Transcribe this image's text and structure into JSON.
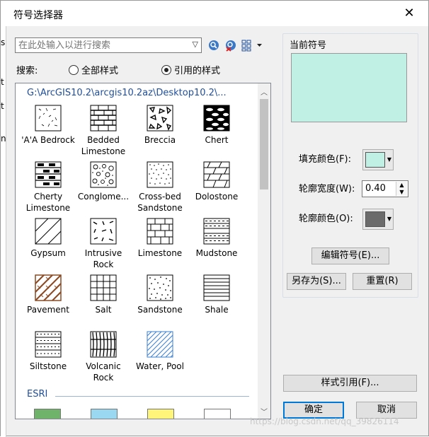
{
  "window": {
    "title": "符号选择器",
    "close_glyph": "✕"
  },
  "left_strip": {
    "fragments": [
      "s",
      "t",
      "t",
      "n"
    ]
  },
  "search": {
    "placeholder": "在此处输入以进行搜索",
    "label": "搜索:"
  },
  "scope": {
    "all_styles": "全部样式",
    "referenced_styles": "引用的样式",
    "selected": "referenced_styles"
  },
  "list": {
    "path": "G:\\ArcGIS10.2\\arcgis10.2az\\Desktop10.2\\...",
    "symbols": [
      {
        "label": "'A'A Bedrock",
        "icon": "bedrock-pattern"
      },
      {
        "label": "Bedded Limestone",
        "icon": "bedded-limestone-pattern"
      },
      {
        "label": "Breccia",
        "icon": "breccia-pattern"
      },
      {
        "label": "Chert",
        "icon": "chert-pattern"
      },
      {
        "label": "Cherty Limestone",
        "icon": "cherty-limestone-pattern"
      },
      {
        "label": "Conglome...",
        "icon": "conglomerate-pattern"
      },
      {
        "label": "Cross-bed Sandstone",
        "icon": "cross-bed-sandstone-pattern"
      },
      {
        "label": "Dolostone",
        "icon": "dolostone-pattern"
      },
      {
        "label": "Gypsum",
        "icon": "gypsum-pattern"
      },
      {
        "label": "Intrusive Rock",
        "icon": "intrusive-rock-pattern"
      },
      {
        "label": "Limestone",
        "icon": "limestone-pattern"
      },
      {
        "label": "Mudstone",
        "icon": "mudstone-pattern"
      },
      {
        "label": "Pavement",
        "icon": "pavement-pattern"
      },
      {
        "label": "Salt",
        "icon": "salt-pattern"
      },
      {
        "label": "Sandstone",
        "icon": "sandstone-pattern"
      },
      {
        "label": "Shale",
        "icon": "shale-pattern"
      },
      {
        "label": "Siltstone",
        "icon": "siltstone-pattern"
      },
      {
        "label": "Volcanic Rock",
        "icon": "volcanic-rock-pattern"
      },
      {
        "label": "Water, Pool",
        "icon": "water-pool-pattern"
      }
    ],
    "esri_group": "ESRI",
    "esri_swatches": [
      "#6fb26a",
      "#9ad7f0",
      "#fff57a",
      "#ffffff"
    ]
  },
  "current_symbol": {
    "group_title": "当前符号",
    "fill_color_label": "填充颜色(F):",
    "fill_color": "#bff0e3",
    "outline_width_label": "轮廓宽度(W):",
    "outline_width": "0.40",
    "outline_color_label": "轮廓颜色(O):",
    "outline_color": "#6b6b6b",
    "edit_button": "编辑符号(E)...",
    "save_as_button": "另存为(S)...",
    "reset_button": "重置(R)"
  },
  "style_refs_button": "样式引用(F)...",
  "ok_button": "确定",
  "cancel_button": "取消",
  "watermark": "https://blog.csdn.net/qq_39826114"
}
